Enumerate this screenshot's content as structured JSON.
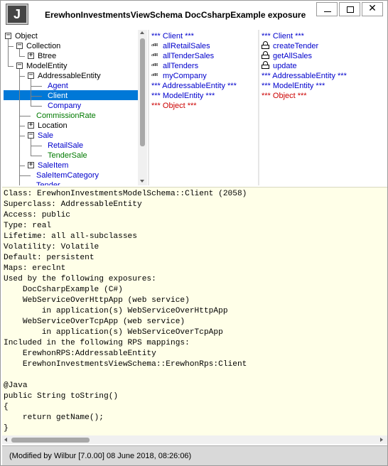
{
  "window": {
    "icon_letter": "J",
    "title": "ErewhonInvestmentsViewSchema DocCsharpExample exposure",
    "minimize_glyph": "",
    "maximize_glyph": "",
    "close_glyph": "✕"
  },
  "tree": {
    "items": [
      {
        "label": "Object",
        "color": "black",
        "expander": "−"
      },
      {
        "label": "Collection",
        "color": "black",
        "expander": "−"
      },
      {
        "label": "Btree",
        "color": "black",
        "expander": "+"
      },
      {
        "label": "ModelEntity",
        "color": "black",
        "expander": "−"
      },
      {
        "label": "AddressableEntity",
        "color": "black",
        "expander": "−"
      },
      {
        "label": "Agent",
        "color": "blue",
        "expander": ""
      },
      {
        "label": "Client",
        "color": "white",
        "expander": "",
        "selected": true
      },
      {
        "label": "Company",
        "color": "blue",
        "expander": ""
      },
      {
        "label": "CommissionRate",
        "color": "green",
        "expander": ""
      },
      {
        "label": "Location",
        "color": "black",
        "expander": "+"
      },
      {
        "label": "Sale",
        "color": "blue",
        "expander": "−"
      },
      {
        "label": "RetailSale",
        "color": "blue",
        "expander": ""
      },
      {
        "label": "TenderSale",
        "color": "green",
        "expander": ""
      },
      {
        "label": "SaleItem",
        "color": "blue",
        "expander": "+"
      },
      {
        "label": "SaleItemCategory",
        "color": "blue",
        "expander": ""
      },
      {
        "label": "Tender",
        "color": "blue",
        "expander": ""
      }
    ]
  },
  "properties": {
    "items": [
      {
        "label": "*** Client ***",
        "color": "blue",
        "icon": ""
      },
      {
        "label": "allRetailSales",
        "color": "blue",
        "icon": "reference-icon"
      },
      {
        "label": "allTenderSales",
        "color": "blue",
        "icon": "reference-icon"
      },
      {
        "label": "allTenders",
        "color": "blue",
        "icon": "reference-icon"
      },
      {
        "label": "myCompany",
        "color": "blue",
        "icon": "reference-icon"
      },
      {
        "label": "*** AddressableEntity ***",
        "color": "blue",
        "icon": ""
      },
      {
        "label": "*** ModelEntity ***",
        "color": "blue",
        "icon": ""
      },
      {
        "label": "*** Object ***",
        "color": "red",
        "icon": ""
      }
    ],
    "ref_glyph": "ℎᵣ⁄"
  },
  "methods": {
    "items": [
      {
        "label": "*** Client ***",
        "color": "blue",
        "icon": ""
      },
      {
        "label": "createTender",
        "color": "blue",
        "icon": "lock-icon"
      },
      {
        "label": "getAllSales",
        "color": "blue",
        "icon": "lock-icon"
      },
      {
        "label": "update",
        "color": "blue",
        "icon": "lock-icon"
      },
      {
        "label": "*** AddressableEntity ***",
        "color": "blue",
        "icon": ""
      },
      {
        "label": "*** ModelEntity ***",
        "color": "blue",
        "icon": ""
      },
      {
        "label": "*** Object ***",
        "color": "red",
        "icon": ""
      }
    ]
  },
  "source": {
    "text": "Class: ErewhonInvestmentsModelSchema::Client (2058)\nSuperclass: AddressableEntity\nAccess: public\nType: real\nLifetime: all all-subclasses\nVolatility: Volatile\nDefault: persistent\nMaps: ereclnt\nUsed by the following exposures:\n    DocCsharpExample (C#)\n    WebServiceOverHttpApp (web service)\n        in application(s) WebServiceOverHttpApp\n    WebServiceOverTcpApp (web service)\n        in application(s) WebServiceOverTcpApp\nIncluded in the following RPS mappings:\n    ErewhonRPS:AddressableEntity\n    ErewhonInvestmentsViewSchema::ErewhonRps:Client\n\n@Java\npublic String toString()\n{\n    return getName();\n}"
  },
  "status": {
    "text": "(Modified by Wilbur [7.0.00] 08 June 2018, 08:26:06)"
  },
  "colors": {
    "blue": "#0000cc",
    "green": "#007a00",
    "red": "#cc0000",
    "selection": "#0078d7",
    "source_bg": "#ffffe8"
  }
}
